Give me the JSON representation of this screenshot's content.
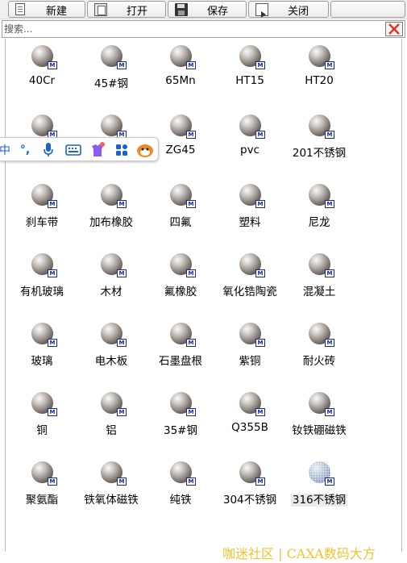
{
  "toolbar": {
    "buttons": [
      {
        "label": "新建",
        "icon": "new-file-icon"
      },
      {
        "label": "打开",
        "icon": "open-file-icon"
      },
      {
        "label": "保存",
        "icon": "save-disk-icon"
      },
      {
        "label": "关闭",
        "icon": "close-file-icon"
      }
    ]
  },
  "search": {
    "placeholder": "搜索...",
    "value": "",
    "clear_icon": "red-x-icon",
    "clear_color": "#e0301e"
  },
  "materials": [
    "40Cr",
    "45#钢",
    "65Mn",
    "HT15",
    "HT20",
    "",
    "",
    "ZG45",
    "pvc",
    "201不锈钢",
    "刹车带",
    "加布橡胶",
    "四氟",
    "塑料",
    "尼龙",
    "有机玻璃",
    "木材",
    "氟橡胶",
    "氧化锆陶瓷",
    "混凝土",
    "玻璃",
    "电木板",
    "石墨盘根",
    "紫铜",
    "耐火砖",
    "铜",
    "铝",
    "35#钢",
    "Q355B",
    "钕铁硼磁铁",
    "聚氨酯",
    "铁氧体磁铁",
    "纯铁",
    "304不锈钢",
    "316不锈钢"
  ],
  "material_icon": "material-sphere-icon",
  "material_badge": "M",
  "selected_material": "316不锈钢",
  "ime_toolbar": {
    "mode_label": "中",
    "punct_label": "°,",
    "icons": [
      "mic-icon",
      "keyboard-icon",
      "skin-icon",
      "apps-grid-icon",
      "mascot-icon"
    ]
  },
  "watermark": {
    "text": "咖迷社区 | CAXA数码大方",
    "color": "#f2c232"
  }
}
